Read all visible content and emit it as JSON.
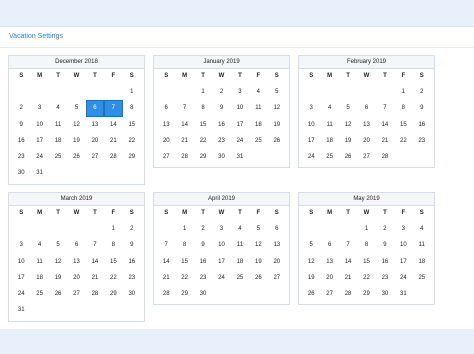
{
  "panel": {
    "title": "Vacation Settings"
  },
  "weekdays": [
    "S",
    "M",
    "T",
    "W",
    "T",
    "F",
    "S"
  ],
  "months": [
    {
      "name": "December 2018",
      "start": 6,
      "days": 31,
      "selected": [
        6,
        7
      ]
    },
    {
      "name": "January 2019",
      "start": 2,
      "days": 31,
      "selected": []
    },
    {
      "name": "February 2019",
      "start": 5,
      "days": 28,
      "selected": []
    },
    {
      "name": "March 2019",
      "start": 5,
      "days": 31,
      "selected": []
    },
    {
      "name": "April 2019",
      "start": 1,
      "days": 30,
      "selected": []
    },
    {
      "name": "May 2019",
      "start": 3,
      "days": 31,
      "selected": []
    }
  ],
  "colors": {
    "accent": "#2f8fe6",
    "background": "#e8f1fb"
  }
}
